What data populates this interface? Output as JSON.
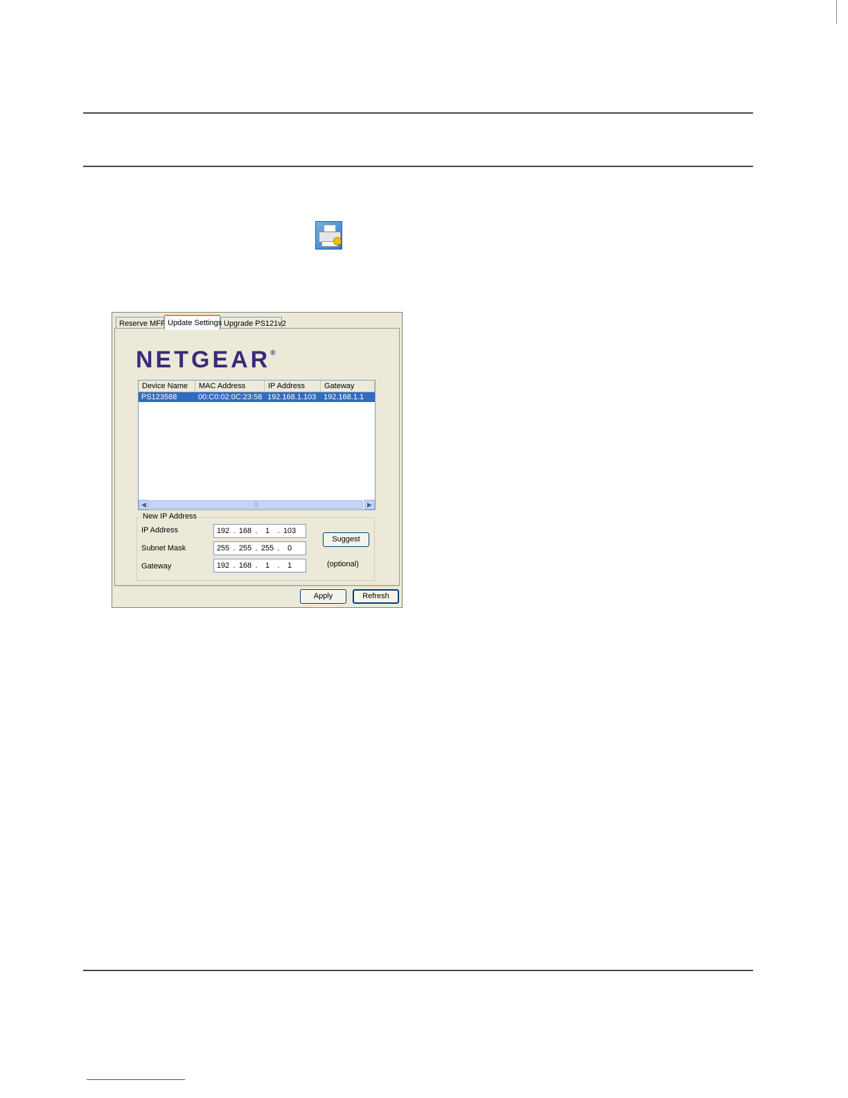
{
  "dialog": {
    "tabs": [
      {
        "label": "Reserve MFP"
      },
      {
        "label": "Update Settings"
      },
      {
        "label": "Upgrade PS121v2"
      }
    ],
    "logo": {
      "text": "NETGEAR",
      "mark": "®"
    },
    "device_list": {
      "columns": [
        "Device Name",
        "MAC Address",
        "IP Address",
        "Gateway"
      ],
      "rows": [
        {
          "device_name": "PS123588",
          "mac_address": "00:C0:02:0C:23:58",
          "ip_address": "192.168.1.103",
          "gateway": "192.168.1.1"
        }
      ]
    },
    "new_ip": {
      "legend": "New IP Address",
      "ip_label": "IP Address",
      "ip": [
        "192",
        "168",
        "1",
        "103"
      ],
      "mask_label": "Subnet Mask",
      "mask": [
        "255",
        "255",
        "255",
        "0"
      ],
      "gateway_label": "Gateway",
      "gateway": [
        "192",
        "168",
        "1",
        "1"
      ],
      "suggest_label": "Suggest",
      "optional_label": "(optional)"
    },
    "apply_label": "Apply",
    "refresh_label": "Refresh"
  },
  "colors": {
    "accent_selection": "#316ac5",
    "logo": "#3a2a7a",
    "dialog_bg": "#ece9d8"
  },
  "icons": {
    "app_icon": "printer-icon",
    "scroll_left": "arrow-left-icon",
    "scroll_right": "arrow-right-icon"
  }
}
